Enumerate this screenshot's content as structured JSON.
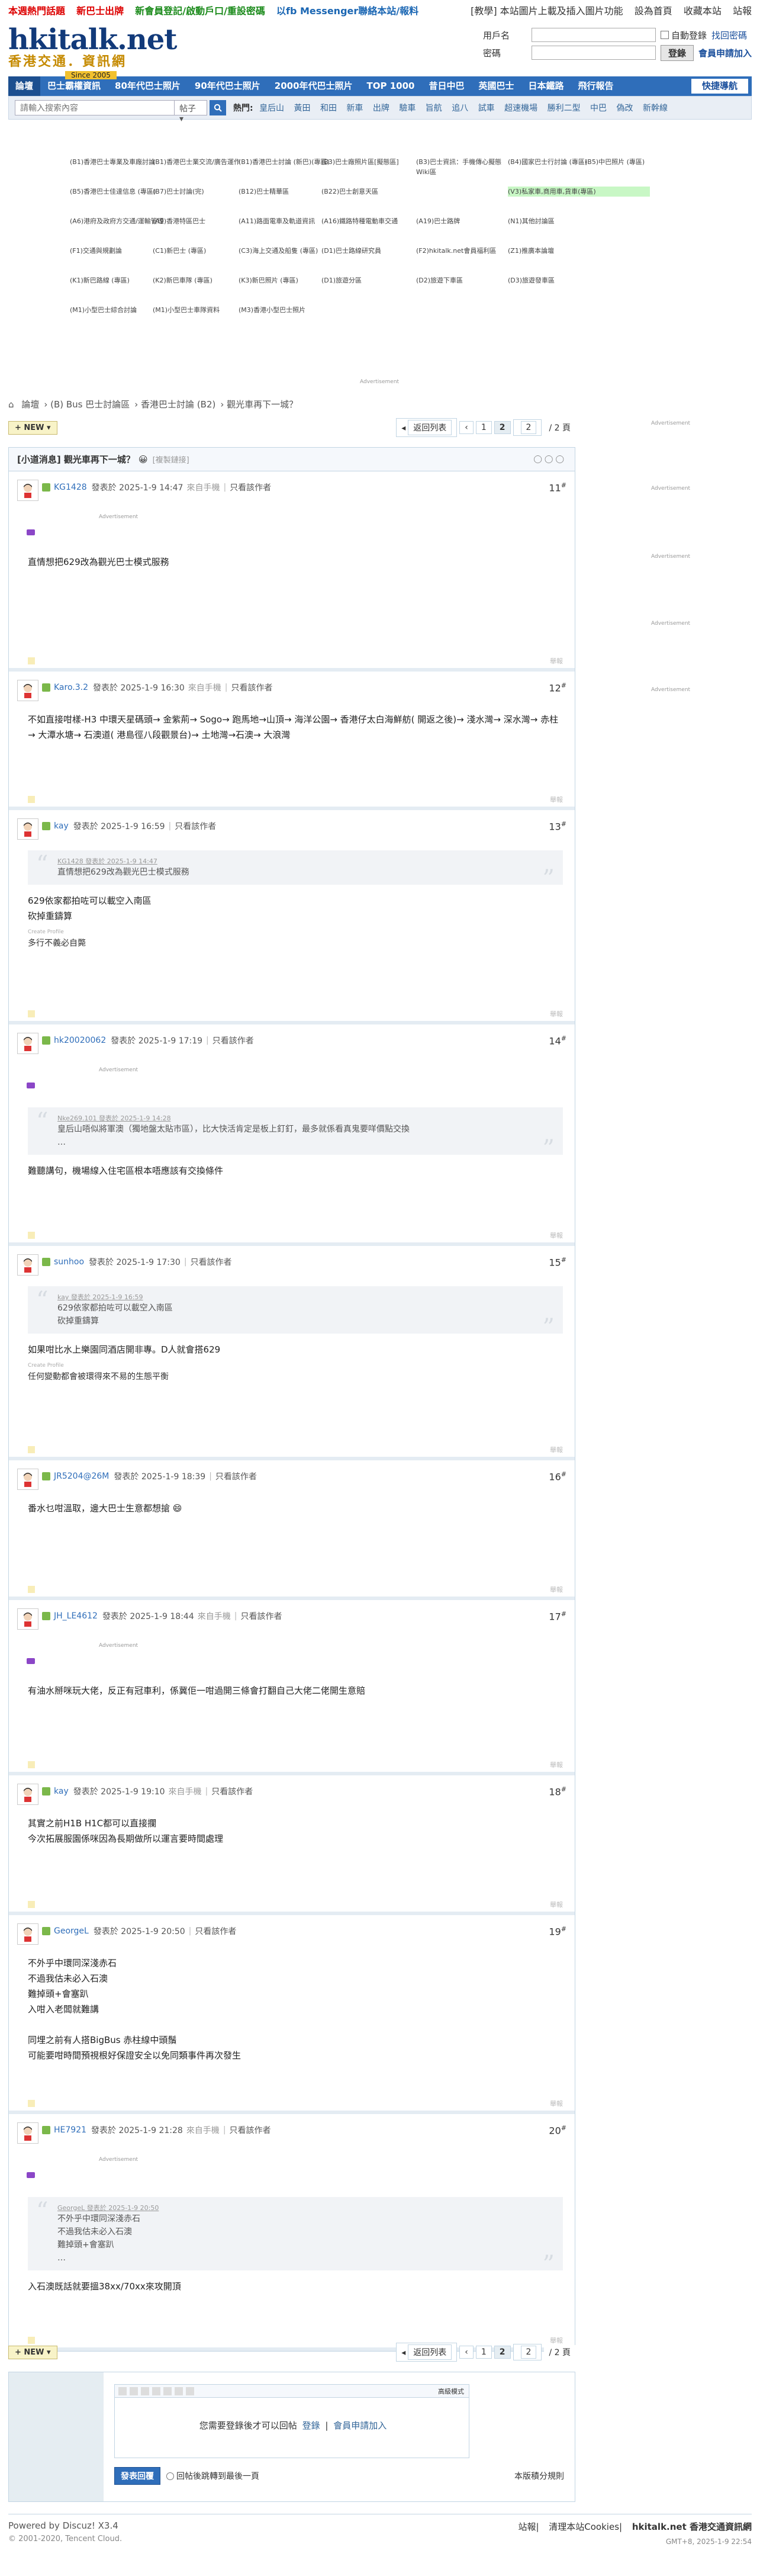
{
  "topbar": {
    "left": [
      "本週熱門話題",
      "新巴士出牌",
      "新會員登記/啟動戶口/重設密碼",
      "以fb Messenger聯絡本站/報料"
    ],
    "right": [
      "[教學] 本站圖片上載及插入圖片功能",
      "設為首頁",
      "收藏本站",
      "站報"
    ]
  },
  "logo": {
    "main": "hkitalk.net",
    "sub": "香港交通．資訊網",
    "since": "Since 2005"
  },
  "login": {
    "user_label": "用戶名",
    "pass_label": "密碼",
    "auto_login": "自動登錄",
    "forgot": "找回密碼",
    "login_button": "登錄",
    "register": "會員申請加入"
  },
  "nav": {
    "items": [
      "論壇",
      "巴士霸權資訊",
      "80年代巴士照片",
      "90年代巴士照片",
      "2000年代巴士照片",
      "TOP 1000",
      "昔日中巴",
      "英國巴士",
      "日本鐵路",
      "飛行報告"
    ],
    "quick": "快捷導航"
  },
  "search": {
    "placeholder": "請輸入搜索內容",
    "type": "帖子",
    "hot_label": "熱門:",
    "hot": [
      "皇后山",
      "黃田",
      "和田",
      "新車",
      "出牌",
      "驗車",
      "旨航",
      "追八",
      "試車",
      "超速機場",
      "勝利二型",
      "中巴",
      "偽改",
      "新幹線"
    ]
  },
  "forum_links": [
    "(B1)香港巴士專業及車廠討論",
    "(B1)香港巴士業交流/廣告運作",
    "(B1)香港巴士討論 (新巴)(專區)",
    "(B3)巴士廠照片區[擬態區]",
    "(B3)巴士資訊：手機傳心擬態Wiki區",
    "(B4)國家巴士行討論 (專區)",
    "(B5)中巴照片 (專區)",
    "(B5)香港巴士佳達信息 (專區)",
    "(B7)巴士討論(完)",
    "(B12)巴士精華區",
    "(B22)巴士創意天區",
    "(V3)私家車,商用車,貨車(專區)",
    "(A6)港府及政府方交通/運輸管理",
    "(A9)香港特區巴士",
    "(A11)路面電車及軌道資訊",
    "(A16)鐵路特種電動車交通",
    "(A19)巴士路牌",
    "(N1)其他討論區",
    "(F1)交通與規劃論",
    "(C1)新巴士 (專區)",
    "(C3)海上交通及船隻 (專區)",
    "(D1)巴士路線研究員",
    "(F2)hkitalk.net會員福利區",
    "(Z1)推廣本論壇",
    "(K1)新巴路線 (專區)",
    "(K2)新巴車隊 (專區)",
    "(K3)新巴照片 (專區)",
    "(D1)旅遊分區",
    "(D2)旅遊下車區",
    "(D3)旅遊發車區",
    "(M1)小型巴士綜合討論",
    "(M1)小型巴士車隊資料",
    "(M3)香港小型巴士照片"
  ],
  "advertisement_label": "Advertisement",
  "breadcrumb": [
    "論壇",
    "(B) Bus 巴士討論區",
    "香港巴士討論 (B2)",
    "觀光車再下一城？"
  ],
  "pager": {
    "new_label": "NEW",
    "back": "返回列表",
    "pages": [
      "1",
      "2"
    ],
    "current": "2",
    "total": "/ 2 頁"
  },
  "thread": {
    "title": "[小道消息] 觀光車再下一城？",
    "copy_link": "[複製鏈接]",
    "icons": "◯◯◯"
  },
  "posts": [
    {
      "floor": "11",
      "user": "KG1428",
      "time": "發表於 2025-1-9 14:47",
      "mobile": "來自手機",
      "only": "只看該作者",
      "quote": null,
      "lines": [
        "直情想把629改為觀光巴士模式服務"
      ]
    },
    {
      "floor": "12",
      "user": "Karo.3.2",
      "time": "發表於 2025-1-9 16:30",
      "mobile": "來自手機",
      "only": "只看該作者",
      "quote": null,
      "lines": [
        "不如直接咁樣-H3 中環天星碼頭→ 金紫荊→ Sogo→ 跑馬地→山頂→ 海洋公園→ 香港仔太白海鮮舫( 開返之後)→ 淺水灣→ 深水灣→ 赤柱→ 大潭水塘→ 石澳道( 港島徑八段觀景台)→ 土地灣→石澳→ 大浪灣"
      ]
    },
    {
      "floor": "13",
      "user": "kay",
      "time": "發表於 2025-1-9 16:59",
      "mobile": "",
      "only": "只看該作者",
      "quote": {
        "head": "KG1428 發表於 2025-1-9 14:47",
        "lines": [
          "直情想把629改為觀光巴士模式服務"
        ]
      },
      "lines": [
        "629依家都拍咗可以載空入南區",
        "砍掉重鑄算"
      ],
      "sig_label": "Create Profile",
      "sig": "多行不義必自斃"
    },
    {
      "floor": "14",
      "user": "hk20020062",
      "time": "發表於 2025-1-9 17:19",
      "mobile": "",
      "only": "只看該作者",
      "quote": {
        "head": "Nke269.101 發表於 2025-1-9 14:28",
        "lines": [
          "皇后山唔似將軍澳（獨地盤太貼市區），比大快活肯定是板上釘釘，最多就係看真鬼要咩價點交換",
          "…"
        ]
      },
      "lines": [
        "難聽講句，機場線入住宅區根本唔應該有交換條件"
      ]
    },
    {
      "floor": "15",
      "user": "sunhoo",
      "time": "發表於 2025-1-9 17:30",
      "mobile": "",
      "only": "只看該作者",
      "quote": {
        "head": "kay 發表於 2025-1-9 16:59",
        "lines": [
          "629依家都拍咗可以載空入南區",
          "砍掉重鑄算"
        ]
      },
      "lines": [
        "如果咁比水上樂園同酒店開非專。D人就會搭629"
      ],
      "sig_label": "Create Profile",
      "sig": "任何變動都會被環得來不易的生態平衡"
    },
    {
      "floor": "16",
      "user": "JR5204@26M",
      "time": "發表於 2025-1-9 18:39",
      "mobile": "",
      "only": "只看該作者",
      "quote": null,
      "lines": [
        "番水乜咁溫取，邊大巴士生意都想搶 😄"
      ]
    },
    {
      "floor": "17",
      "user": "JH_LE4612",
      "time": "發表於 2025-1-9 18:44",
      "mobile": "來自手機",
      "only": "只看該作者",
      "quote": null,
      "lines": [
        "有油水掰咪玩大佬，反正有冠車利，係冀佢一咁過開三條會打翻自己大佬二佬開生意賠"
      ]
    },
    {
      "floor": "18",
      "user": "kay",
      "time": "發表於 2025-1-9 19:10",
      "mobile": "來自手機",
      "only": "只看該作者",
      "quote": null,
      "lines": [
        "其實之前H1B H1C都可以直接攔",
        "今次拓展服園係咪因為長期做所以運言要時間處理"
      ]
    },
    {
      "floor": "19",
      "user": "GeorgeL",
      "time": "發表於 2025-1-9 20:50",
      "mobile": "",
      "only": "只看該作者",
      "quote": null,
      "lines": [
        "不外乎中環同深淺赤石",
        "不過我估未必入石澳",
        "難掉頭+會塞趴",
        "入咁入老闆就難講",
        "",
        "同埋之前有人搭BigBus 赤柱線中頭鬚",
        "可能要咁時間預視根好保證安全以免同類事件再次發生"
      ]
    },
    {
      "floor": "20",
      "user": "HE7921",
      "time": "發表於 2025-1-9 21:28",
      "mobile": "來自手機",
      "only": "只看該作者",
      "quote": {
        "head": "GeorgeL 發表於 2025-1-9 20:50",
        "lines": [
          "不外乎中環同深淺赤石",
          "不過我估未必入石澳",
          "難掉頭+會塞趴",
          "…"
        ]
      },
      "lines": [
        "入石澳既話就要搵38xx/70xx來攻開頂"
      ]
    }
  ],
  "report_label": "舉報",
  "reply": {
    "advanced": "高級模式",
    "need_login": "您需要登錄後才可以回帖",
    "login": "登錄",
    "sep": "|",
    "register": "會員申請加入",
    "submit": "發表回覆",
    "jump": "回帖後跳轉到最後一頁",
    "rules": "本版積分規則"
  },
  "footer": {
    "powered": "Powered by Discuz! X3.4",
    "copyright": "© 2001-2020, Tencent Cloud.",
    "links": [
      "站報",
      "清理本站Cookies",
      "hkitalk.net 香港交通資訊網"
    ],
    "gmt": "GMT+8, 2025-1-9 22:54"
  }
}
